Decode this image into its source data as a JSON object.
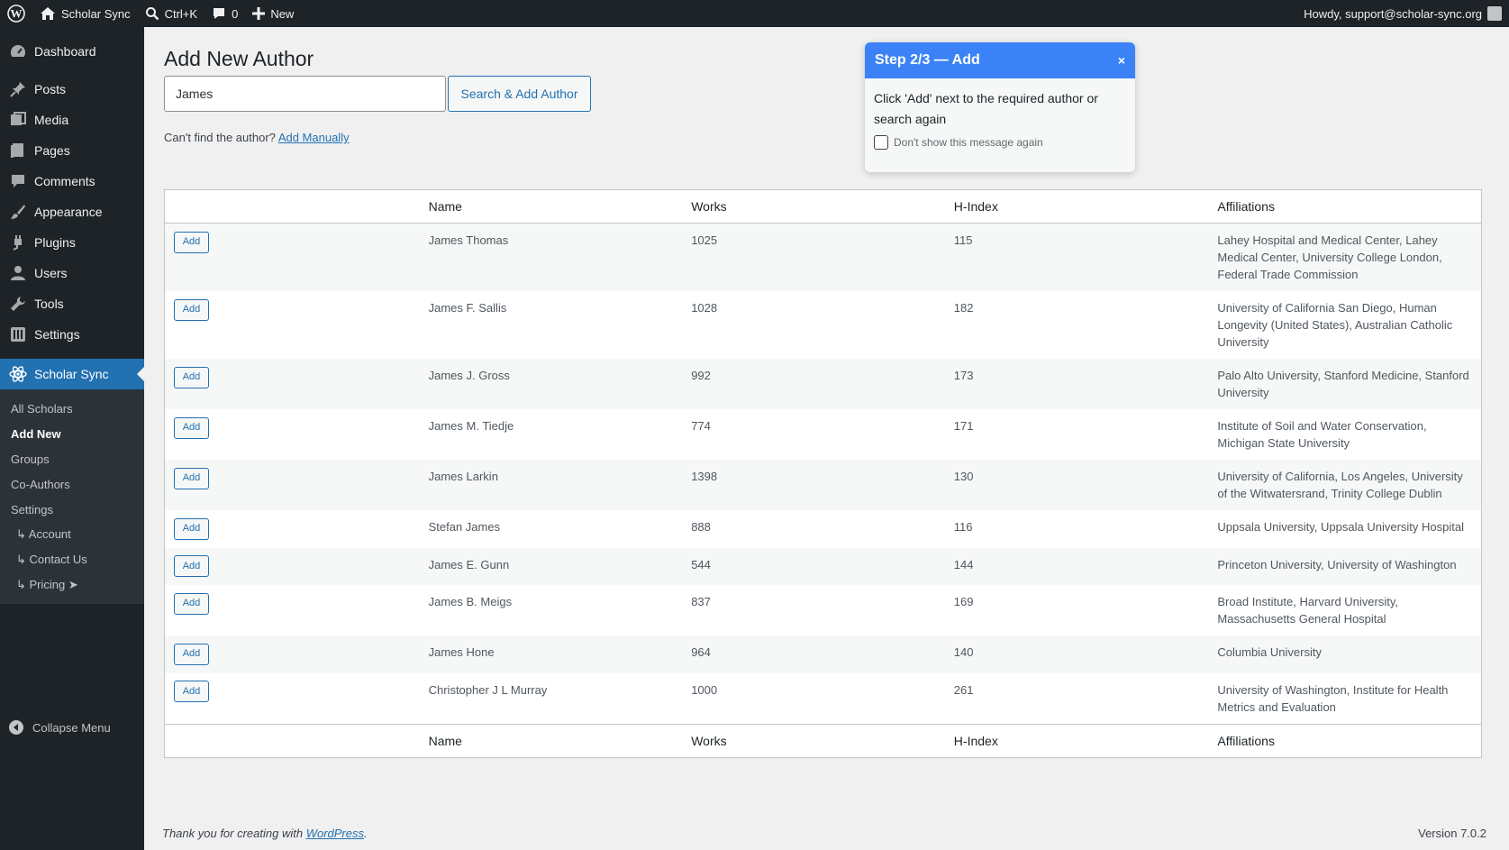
{
  "adminbar": {
    "site_name": "Scholar Sync",
    "search_shortcut": "Ctrl+K",
    "comments_count": "0",
    "new_label": "New",
    "howdy": "Howdy, support@scholar-sync.org"
  },
  "sidebar": {
    "items": [
      {
        "label": "Dashboard",
        "icon": "dashboard-icon"
      },
      {
        "label": "Posts",
        "icon": "pin-icon"
      },
      {
        "label": "Media",
        "icon": "media-icon"
      },
      {
        "label": "Pages",
        "icon": "pages-icon"
      },
      {
        "label": "Comments",
        "icon": "comment-icon"
      },
      {
        "label": "Appearance",
        "icon": "brush-icon"
      },
      {
        "label": "Plugins",
        "icon": "plugin-icon"
      },
      {
        "label": "Users",
        "icon": "user-icon"
      },
      {
        "label": "Tools",
        "icon": "wrench-icon"
      },
      {
        "label": "Settings",
        "icon": "settings-icon"
      }
    ],
    "current": {
      "label": "Scholar Sync",
      "icon": "atom-icon"
    },
    "submenu": [
      "All Scholars",
      "Add New",
      "Groups",
      "Co-Authors",
      "Settings",
      "↳ Account",
      "↳ Contact Us",
      "↳ Pricing  ➤"
    ],
    "collapse_label": "Collapse Menu"
  },
  "page": {
    "title": "Add New Author",
    "search_value": "James",
    "search_button": "Search & Add Author",
    "cant_find": "Can't find the author?",
    "add_manually": "Add Manually"
  },
  "tooltip": {
    "title": "Step 2/3 — Add",
    "close": "×",
    "body": "Click 'Add' next to the required author or search again",
    "checkbox_label": "Don't show this message again"
  },
  "table": {
    "headers": [
      "",
      "Name",
      "Works",
      "H-Index",
      "Affiliations"
    ],
    "add_label": "Add",
    "rows": [
      {
        "name": "James Thomas",
        "works": "1025",
        "hindex": "115",
        "affiliations": "Lahey Hospital and Medical Center, Lahey Medical Center, University College London, Federal Trade Commission"
      },
      {
        "name": "James F. Sallis",
        "works": "1028",
        "hindex": "182",
        "affiliations": "University of California San Diego, Human Longevity (United States), Australian Catholic University"
      },
      {
        "name": "James J. Gross",
        "works": "992",
        "hindex": "173",
        "affiliations": "Palo Alto University, Stanford Medicine, Stanford University"
      },
      {
        "name": "James M. Tiedje",
        "works": "774",
        "hindex": "171",
        "affiliations": "Institute of Soil and Water Conservation, Michigan State University"
      },
      {
        "name": "James Larkin",
        "works": "1398",
        "hindex": "130",
        "affiliations": "University of California, Los Angeles, University of the Witwatersrand, Trinity College Dublin"
      },
      {
        "name": "Stefan James",
        "works": "888",
        "hindex": "116",
        "affiliations": "Uppsala University, Uppsala University Hospital"
      },
      {
        "name": "James E. Gunn",
        "works": "544",
        "hindex": "144",
        "affiliations": "Princeton University, University of Washington"
      },
      {
        "name": "James B. Meigs",
        "works": "837",
        "hindex": "169",
        "affiliations": "Broad Institute, Harvard University, Massachusetts General Hospital"
      },
      {
        "name": "James Hone",
        "works": "964",
        "hindex": "140",
        "affiliations": "Columbia University"
      },
      {
        "name": "Christopher J L Murray",
        "works": "1000",
        "hindex": "261",
        "affiliations": "University of Washington, Institute for Health Metrics and Evaluation"
      }
    ]
  },
  "footer": {
    "thanks": "Thank you for creating with",
    "wp_link": "WordPress",
    "period": ".",
    "version": "Version 7.0.2"
  }
}
